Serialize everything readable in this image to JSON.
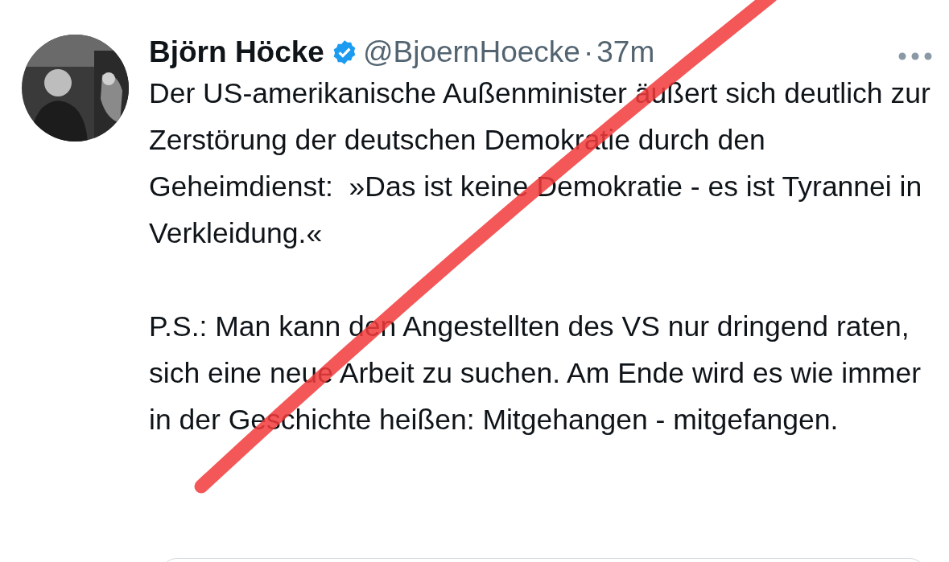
{
  "tweet": {
    "author_name": "Björn Höcke",
    "verified": true,
    "handle": "@BjoernHoecke",
    "separator": "·",
    "time": "37m",
    "paragraphs": [
      "Der US-amerikanische Außenminister äußert sich deutlich zur Zerstörung der deutschen Demokratie durch den Geheimdienst:  »Das ist keine Demokratie - es ist Tyrannei in Verkleidung.«",
      "P.S.: Man kann den Angestellten des VS nur dringend raten, sich eine neue Arbeit zu suchen. Am Ende wird es wie immer in der Geschichte heißen: Mitgehangen - mitgefangen."
    ]
  }
}
